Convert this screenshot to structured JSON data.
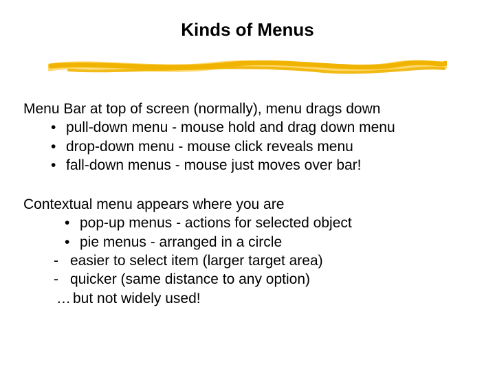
{
  "title": "Kinds of Menus",
  "section1": {
    "heading": "Menu Bar at top of screen (normally), menu drags down",
    "bullets": [
      "pull-down menu - mouse hold and drag down menu",
      "drop-down menu - mouse click reveals menu",
      "fall-down menus - mouse just moves over bar!"
    ]
  },
  "section2": {
    "heading": "Contextual menu appears where you are",
    "bullets": [
      "pop-up menus - actions for selected object",
      "pie menus - arranged in a circle"
    ],
    "dashes": [
      "easier to select item (larger target area)",
      "quicker (same distance to any option)"
    ],
    "tail_prefix": "…",
    "tail_text": "but not widely used!"
  },
  "glyphs": {
    "bullet": "•",
    "dash": "-"
  },
  "colors": {
    "stroke_main": "#f0b400",
    "stroke_light": "#ffd76a"
  }
}
